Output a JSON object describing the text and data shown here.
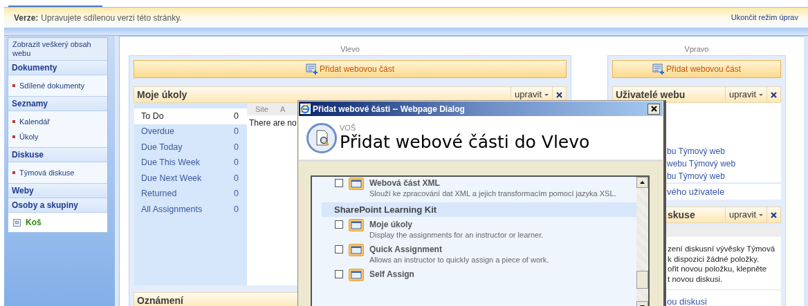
{
  "version_bar": {
    "label": "Verze:",
    "message": "Upravujete sdílenou verzi této stránky.",
    "exit_link": "Ukončit režim úprav"
  },
  "quick_launch": {
    "view_all": "Zobrazit veškerý obsah webu",
    "sections": [
      {
        "heading": "Dokumenty",
        "items": [
          "Sdílené dokumenty"
        ]
      },
      {
        "heading": "Seznamy",
        "items": [
          "Kalendář",
          "Úkoly"
        ]
      },
      {
        "heading": "Diskuse",
        "items": [
          "Týmová diskuse"
        ]
      },
      {
        "heading": "Weby"
      },
      {
        "heading": "Osoby a skupiny"
      }
    ],
    "recycle_bin": "Koš"
  },
  "left_zone": {
    "title": "Vlevo",
    "add_button": "Přidat webovou část",
    "my_tasks": {
      "title": "Moje úkoly",
      "edit_menu": "upravit",
      "filters": [
        {
          "label": "To Do",
          "count": "0",
          "selected": true
        },
        {
          "label": "Overdue",
          "count": "0",
          "selected": false
        },
        {
          "label": "Due Today",
          "count": "0",
          "selected": false
        },
        {
          "label": "Due This Week",
          "count": "0",
          "selected": false
        },
        {
          "label": "Due Next Week",
          "count": "0",
          "selected": false
        },
        {
          "label": "Returned",
          "count": "0",
          "selected": false
        },
        {
          "label": "All Assignments",
          "count": "0",
          "selected": false
        }
      ],
      "columns": [
        "Site",
        "A"
      ],
      "empty_message": "There are no"
    },
    "announcements": {
      "title": "Oznámení"
    }
  },
  "right_zone": {
    "title": "Vpravo",
    "add_button": "Přidat webovou část",
    "site_users": {
      "title": "Uživatelé webu",
      "edit_menu": "upravit",
      "links": [
        "bu Týmový web",
        "webu Týmový web",
        "bu Týmový web"
      ],
      "footer_link": "vého uživatele"
    },
    "discussion": {
      "title": "skuse",
      "edit_menu": "upravit",
      "message_lines": [
        "zení diskusní vývěsky Týmová",
        "k dispozici žádné položky.",
        "ořit novou položku, klepněte",
        "t novou diskusi."
      ],
      "footer_link": "ou diskusi"
    }
  },
  "dialog": {
    "title": "Přidat webové části -- Webpage Dialog",
    "site": "VOŠ",
    "heading": "Přidat webové části do Vlevo",
    "entries": [
      {
        "kind": "item",
        "title": "Webová část XML",
        "description": "Slouží ke zpracování dat XML a jejich transformacím pomocí jazyka XSL.",
        "checked": false
      },
      {
        "kind": "group",
        "title": "SharePoint Learning Kit"
      },
      {
        "kind": "item",
        "title": "Moje úkoly",
        "description": "Display the assignments for an instructor or learner.",
        "checked": false
      },
      {
        "kind": "item",
        "title": "Quick Assignment",
        "description": "Allows an instructor to quickly assign a piece of work.",
        "checked": false
      },
      {
        "kind": "item",
        "title": "Self Assign",
        "checked": false
      }
    ]
  }
}
